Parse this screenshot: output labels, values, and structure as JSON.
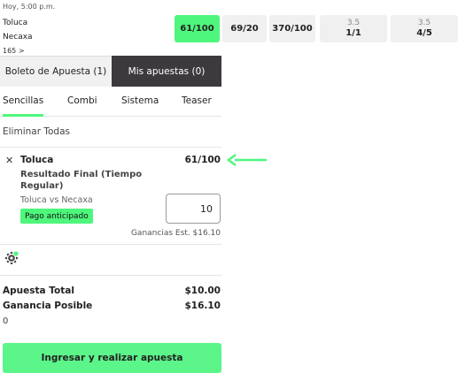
{
  "match": {
    "time": "Hoy, 5:00 p.m.",
    "home_team": "Toluca",
    "away_team": "Necaxa",
    "more_markets": "165 >",
    "odds": [
      {
        "price": "61/100",
        "selected": true
      },
      {
        "price": "69/20",
        "selected": false
      },
      {
        "price": "370/100",
        "selected": false
      },
      {
        "line": "3.5",
        "price": "1/1",
        "selected": false
      },
      {
        "line": "3.5",
        "price": "4/5",
        "selected": false
      }
    ]
  },
  "betslip": {
    "tab_bet_slip": "Boleto de Apuesta (1)",
    "tab_my_bets": "Mis apuestas (0)",
    "bet_types": [
      "Sencillas",
      "Combi",
      "Sistema",
      "Teaser"
    ],
    "active_bet_type": "Sencillas",
    "clear_all": "Eliminar Todas",
    "selection": {
      "remove_icon": "close-icon",
      "team": "Toluca",
      "odds": "61/100",
      "market": "Resultado Final (Tiempo Regular)",
      "event": "Toluca vs Necaxa",
      "early_payout_badge": "Pago anticipado",
      "stake": "10",
      "estimated_winnings": "Ganancias Est. $16.10"
    },
    "settings_icon": "gear-icon",
    "total_stake_label": "Apuesta Total",
    "total_stake_value": "$10.00",
    "potential_win_label": "Ganancia Posible",
    "potential_win_value": "$16.10",
    "extra_value": "0",
    "submit_label": "Ingresar y realizar apuesta"
  },
  "colors": {
    "accent_green": "#4ef77c",
    "dark_tab": "#3d3a3d"
  }
}
